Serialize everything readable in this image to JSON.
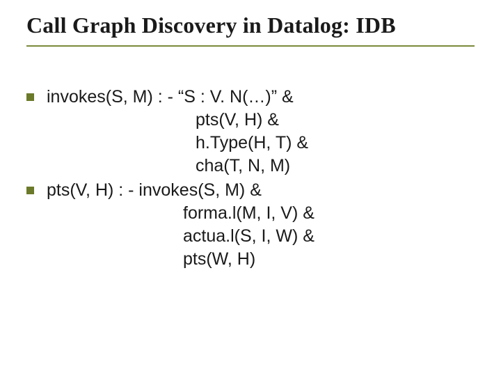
{
  "title": "Call Graph Discovery in Datalog: IDB",
  "items": [
    {
      "head": "invokes(S, M) : - “S : V. N(…)” &",
      "lines": [
        "pts(V, H) &",
        "h.Type(H, T) &",
        "cha(T, N, M)"
      ]
    },
    {
      "head": "pts(V, H) : - invokes(S, M) &",
      "lines": [
        "forma.l(M, I, V) &",
        "actua.l(S, I, W) &",
        "pts(W, H)"
      ]
    }
  ]
}
